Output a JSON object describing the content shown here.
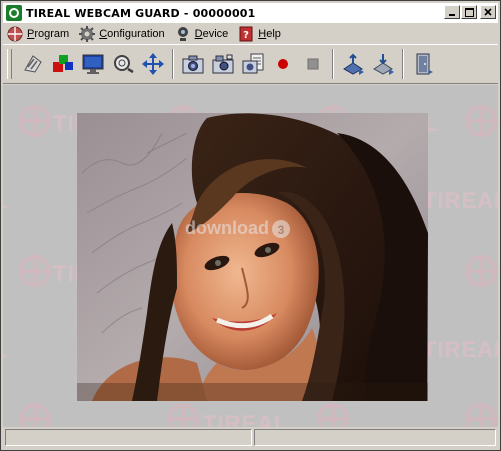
{
  "window": {
    "title": "TIREAL WEBCAM GUARD - 00000001"
  },
  "menu": [
    {
      "label": "Program",
      "icon": "globe-icon"
    },
    {
      "label": "Configuration",
      "icon": "gear-icon"
    },
    {
      "label": "Device",
      "icon": "webcam-icon"
    },
    {
      "label": "Help",
      "icon": "help-book-icon"
    }
  ],
  "toolbar": {
    "tools": [
      {
        "name": "connect-tool",
        "icon": "connector-icon"
      },
      {
        "name": "color-settings-tool",
        "icon": "colored-squares-icon"
      },
      {
        "name": "monitor-tool",
        "icon": "monitor-icon"
      },
      {
        "name": "zoom-tool",
        "icon": "magnifier-icon"
      },
      {
        "name": "move-tool",
        "icon": "four-arrows-icon"
      },
      {
        "name": "capture-tool",
        "icon": "camera-icon"
      },
      {
        "name": "snapshot-tool",
        "icon": "camera-flash-icon"
      },
      {
        "name": "multi-capture-tool",
        "icon": "camera-multi-icon"
      },
      {
        "name": "record-tool",
        "icon": "record-icon"
      },
      {
        "name": "stop-tool",
        "icon": "stop-icon"
      },
      {
        "name": "upload-tool",
        "icon": "upload-icon"
      },
      {
        "name": "download-tool",
        "icon": "download-icon"
      },
      {
        "name": "door-tool",
        "icon": "door-exit-icon"
      }
    ]
  },
  "watermark": {
    "text": "TIREAL",
    "site": "download"
  },
  "statusbar": {
    "panel1": "",
    "panel2": ""
  },
  "colors": {
    "face": "#d4d0c8",
    "client": "#c0c0c0",
    "record": "#cc0000",
    "titlebar": "#ffffff"
  }
}
